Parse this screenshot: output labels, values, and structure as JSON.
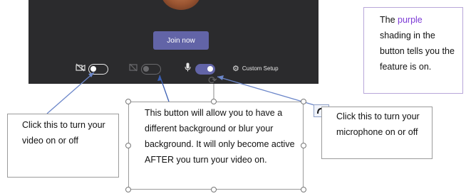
{
  "meeting": {
    "join_label": "Join now",
    "custom_setup_label": "Custom Setup",
    "video_toggle_state": "off",
    "background_toggle_state": "disabled",
    "mic_toggle_state": "on",
    "accent_color": "#6264a7"
  },
  "notes": {
    "purple": {
      "line1_prefix": "The ",
      "highlight": "purple",
      "rest": "shading in the button tells you the feature is on."
    },
    "video": "Click this to turn your video on or off",
    "background": "This button will allow you to have a different background or blur your background. It will only become active AFTER you turn your video on.",
    "mic": "Click this to turn your microphone on or off"
  }
}
